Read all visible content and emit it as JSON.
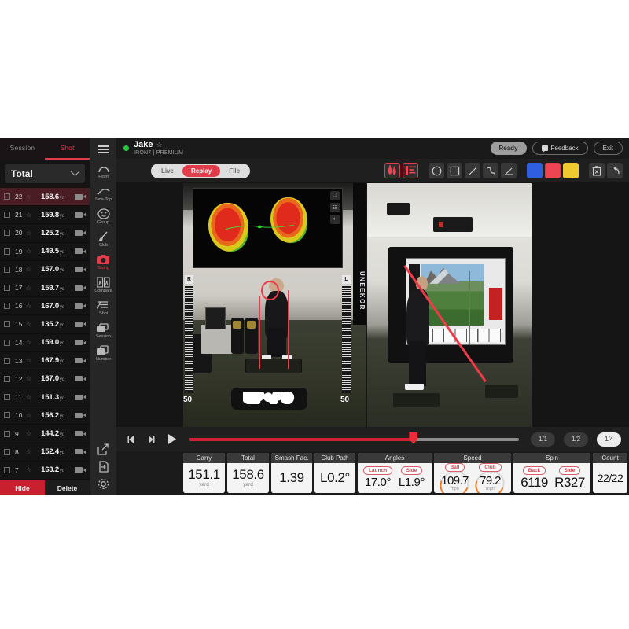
{
  "shot_panel": {
    "tabs": [
      {
        "label": "Session",
        "active": false
      },
      {
        "label": "Shot",
        "active": true
      }
    ],
    "filter": {
      "label": "Total",
      "icon": "chevron-down-icon"
    },
    "columns": [
      "checkbox",
      "number",
      "favorite",
      "distance",
      "video"
    ],
    "rows": [
      {
        "number": "22",
        "distance": "158.6",
        "unit": "yd",
        "selected": true
      },
      {
        "number": "21",
        "distance": "159.8",
        "unit": "yd",
        "selected": false
      },
      {
        "number": "20",
        "distance": "125.2",
        "unit": "yd",
        "selected": false
      },
      {
        "number": "19",
        "distance": "149.5",
        "unit": "yd",
        "selected": false
      },
      {
        "number": "18",
        "distance": "157.0",
        "unit": "yd",
        "selected": false
      },
      {
        "number": "17",
        "distance": "159.7",
        "unit": "yd",
        "selected": false
      },
      {
        "number": "16",
        "distance": "167.0",
        "unit": "yd",
        "selected": false
      },
      {
        "number": "15",
        "distance": "135.2",
        "unit": "yd",
        "selected": false
      },
      {
        "number": "14",
        "distance": "159.0",
        "unit": "yd",
        "selected": false
      },
      {
        "number": "13",
        "distance": "167.9",
        "unit": "yd",
        "selected": false
      },
      {
        "number": "12",
        "distance": "167.0",
        "unit": "yd",
        "selected": false
      },
      {
        "number": "11",
        "distance": "151.3",
        "unit": "yd",
        "selected": false
      },
      {
        "number": "10",
        "distance": "156.2",
        "unit": "yd",
        "selected": false
      },
      {
        "number": "9",
        "distance": "144.2",
        "unit": "yd",
        "selected": false
      },
      {
        "number": "8",
        "distance": "152.4",
        "unit": "yd",
        "selected": false
      },
      {
        "number": "7",
        "distance": "163.2",
        "unit": "yd",
        "selected": false
      }
    ],
    "actions": {
      "hide": "Hide",
      "delete": "Delete"
    }
  },
  "rail": {
    "menu_icon": "hamburger-menu-icon",
    "items": [
      {
        "label": "Front",
        "icon": "front-view-icon",
        "active": false
      },
      {
        "label": "Side·Top",
        "icon": "side-top-view-icon",
        "active": false
      },
      {
        "label": "Group",
        "icon": "group-icon",
        "active": false
      },
      {
        "label": "Club",
        "icon": "club-icon",
        "active": false
      },
      {
        "label": "Swing",
        "icon": "swing-camera-icon",
        "active": true
      },
      {
        "label": "Compare",
        "icon": "compare-icon",
        "active": false
      },
      {
        "label": "Shot",
        "icon": "shot-icon",
        "active": false
      },
      {
        "label": "Session",
        "icon": "session-icon",
        "active": false
      },
      {
        "label": "Number",
        "icon": "number-icon",
        "active": false
      }
    ],
    "bottom_items": [
      {
        "icon": "external-link-icon"
      },
      {
        "icon": "save-export-icon"
      },
      {
        "icon": "settings-gear-icon"
      }
    ]
  },
  "header": {
    "status_icon": "online-status-dot",
    "player_name": "Jake",
    "favorite_icon": "star-outline-icon",
    "club_info": "IRON7 | PREMIUM",
    "buttons": [
      {
        "label": "Ready",
        "style": "solid",
        "icon": ""
      },
      {
        "label": "Feedback",
        "style": "outline",
        "icon": "feedback-icon"
      },
      {
        "label": "Exit",
        "style": "outline",
        "icon": ""
      }
    ]
  },
  "toolbar": {
    "modes": [
      {
        "label": "Live",
        "active": false
      },
      {
        "label": "Replay",
        "active": true
      },
      {
        "label": "File",
        "active": false
      }
    ],
    "analysis_tools": [
      {
        "icon": "footprint-stance-icon",
        "selected": true
      },
      {
        "icon": "alignment-bars-icon",
        "selected": true
      }
    ],
    "draw_tools": [
      {
        "icon": "circle-tool-icon",
        "selected": false
      },
      {
        "icon": "square-tool-icon",
        "selected": false
      },
      {
        "icon": "line-tool-icon",
        "selected": false
      },
      {
        "icon": "freehand-tool-icon",
        "selected": false
      },
      {
        "icon": "angle-tool-icon",
        "selected": false
      }
    ],
    "colors": [
      {
        "name": "blue",
        "hex": "#2f5fe0",
        "selected": false
      },
      {
        "name": "red",
        "hex": "#ef4452",
        "selected": true
      },
      {
        "name": "yellow",
        "hex": "#f0c930",
        "selected": false
      }
    ],
    "edit_tools": [
      {
        "icon": "delete-trash-icon",
        "selected": false
      },
      {
        "icon": "undo-arrow-icon",
        "selected": false
      }
    ]
  },
  "video": {
    "left": {
      "brand": "UNEEKOR",
      "overlay_buttons": [
        {
          "icon": "expand-window-icon"
        },
        {
          "icon": "grid-view-icon"
        },
        {
          "icon": "contrast-icon"
        }
      ],
      "scale_left_tag": "R",
      "scale_right_tag": "L",
      "scale_left_value": "50",
      "scale_right_value": "50"
    },
    "right": {}
  },
  "playback": {
    "controls": [
      {
        "icon": "step-backward-icon"
      },
      {
        "icon": "step-forward-icon"
      },
      {
        "icon": "play-icon"
      }
    ],
    "progress_percent": 68,
    "speeds": [
      {
        "label": "1/1",
        "active": false
      },
      {
        "label": "1/2",
        "active": false
      },
      {
        "label": "1/4",
        "active": true
      }
    ]
  },
  "stats": {
    "carry": {
      "header": "Carry",
      "value": "151.1",
      "unit": "yard"
    },
    "total": {
      "header": "Total",
      "value": "158.6",
      "unit": "yard"
    },
    "smash": {
      "header": "Smash Fac.",
      "value": "1.39",
      "unit": ""
    },
    "path": {
      "header": "Club Path",
      "value": "L0.2°",
      "unit": ""
    },
    "angles": {
      "header": "Angles",
      "launch": {
        "tag": "Launch",
        "value": "17.0°"
      },
      "side": {
        "tag": "Side",
        "value": "L1.9°"
      }
    },
    "speed": {
      "header": "Speed",
      "ball": {
        "tag": "Ball",
        "value": "109.7",
        "unit": "mph"
      },
      "club": {
        "tag": "Club",
        "value": "79.2",
        "unit": "mph"
      }
    },
    "spin": {
      "header": "Spin",
      "back": {
        "tag": "Back",
        "value": "6119"
      },
      "side": {
        "tag": "Side",
        "value": "R327"
      }
    },
    "count": {
      "header": "Count",
      "value": "22/22"
    }
  },
  "theme": {
    "accent_red": "#e23b4a",
    "panel_dark": "#1b1b1b",
    "selected_row": "#4a1c24",
    "hide_button": "#c9202f"
  }
}
